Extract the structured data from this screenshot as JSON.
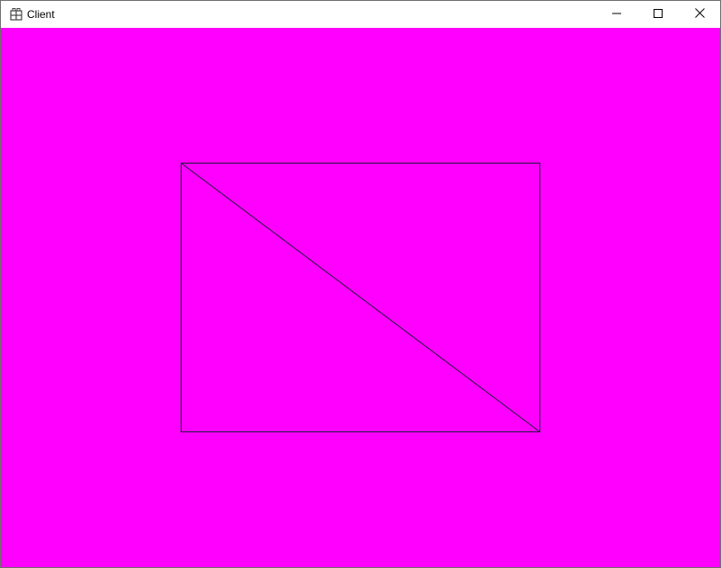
{
  "window": {
    "title": "Client",
    "app_icon": "app-grid-icon",
    "controls": {
      "minimize_icon": "minimize-icon",
      "maximize_icon": "maximize-icon",
      "close_icon": "close-icon"
    }
  },
  "canvas": {
    "background_color": "#ff00ff",
    "stroke_color": "#1a1a3a",
    "shapes": [
      {
        "type": "rectangle",
        "name": "outline-rectangle"
      },
      {
        "type": "line",
        "name": "diagonal-line"
      }
    ]
  }
}
